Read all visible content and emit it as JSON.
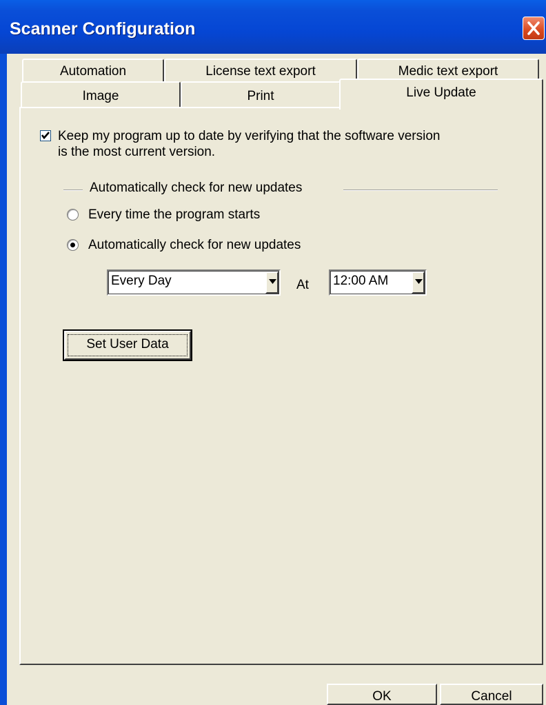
{
  "window": {
    "title": "Scanner Configuration"
  },
  "tabs": {
    "row_back": [
      "Automation",
      "License text export",
      "Medic text export"
    ],
    "row_front": [
      "Image",
      "Print",
      "Live Update"
    ],
    "active": "Live Update"
  },
  "live_update": {
    "keep_updated": {
      "checked": true,
      "label_line1": "Keep my program up to date by verifying that the software version",
      "label_line2": "is the most current version."
    },
    "group_label": "Automatically check for new updates",
    "option_startup": {
      "label": "Every time the program starts",
      "selected": false
    },
    "option_scheduled": {
      "label": "Automatically check for new updates",
      "selected": true
    },
    "frequency_select": {
      "value": "Every Day"
    },
    "at_label": "At",
    "time_select": {
      "value": "12:00 AM"
    },
    "set_user_data_label": "Set User Data"
  },
  "footer": {
    "ok_label": "OK",
    "cancel_label": "Cancel"
  }
}
